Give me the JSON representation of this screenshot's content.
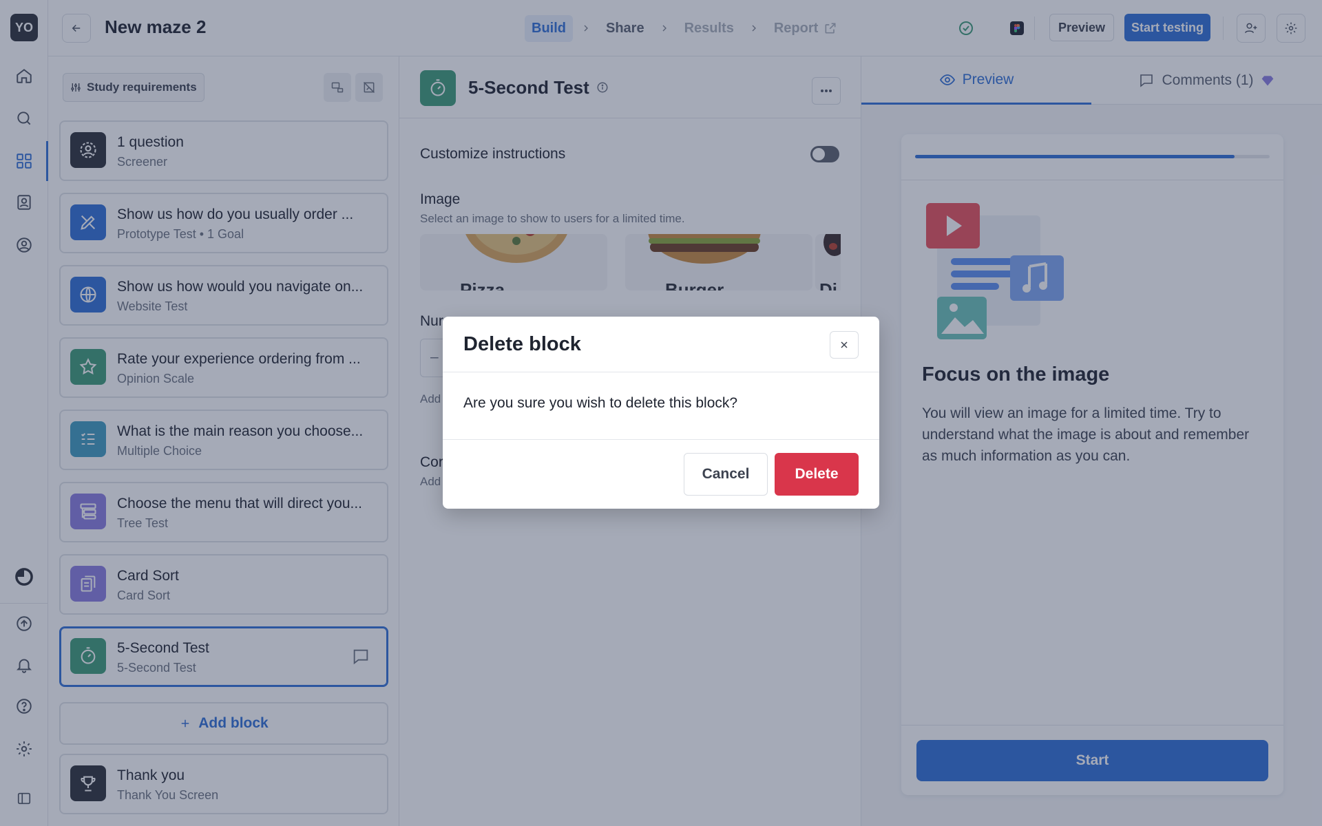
{
  "app": {
    "avatar_initials": "YO"
  },
  "header": {
    "title": "New maze 2",
    "steps": [
      {
        "label": "Build",
        "state": "active"
      },
      {
        "label": "Share",
        "state": "default"
      },
      {
        "label": "Results",
        "state": "disabled"
      },
      {
        "label": "Report",
        "state": "disabled"
      }
    ],
    "preview_label": "Preview",
    "start_testing_label": "Start testing"
  },
  "study": {
    "requirements_label": "Study requirements",
    "blocks": [
      {
        "title": "1 question",
        "subtitle": "Screener",
        "color": "#2b2f38",
        "icon": "screener-icon"
      },
      {
        "title": "Show us how do you usually order ...",
        "subtitle": "Prototype Test • 1 Goal",
        "color": "#2f6fd6",
        "icon": "prototype-icon"
      },
      {
        "title": "Show us how would you navigate on...",
        "subtitle": "Website Test",
        "color": "#2f6fd6",
        "icon": "globe-icon"
      },
      {
        "title": "Rate your experience ordering from ...",
        "subtitle": "Opinion Scale",
        "color": "#3d9c77",
        "icon": "star-icon"
      },
      {
        "title": "What is the main reason you choose...",
        "subtitle": "Multiple Choice",
        "color": "#3e9bc0",
        "icon": "checklist-icon"
      },
      {
        "title": "Choose the menu that will direct you...",
        "subtitle": "Tree Test",
        "color": "#8a7de0",
        "icon": "tree-icon"
      },
      {
        "title": "Card Sort",
        "subtitle": "Card Sort",
        "color": "#8a7de0",
        "icon": "card-sort-icon"
      },
      {
        "title": "5-Second Test",
        "subtitle": "5-Second Test",
        "color": "#3d9c77",
        "icon": "timer-icon",
        "selected": true
      }
    ],
    "add_block_label": "Add block",
    "thank_you": {
      "title": "Thank you",
      "subtitle": "Thank You Screen",
      "color": "#2b2f38",
      "icon": "trophy-icon"
    }
  },
  "editor": {
    "title": "5-Second Test",
    "customize_label": "Customize instructions",
    "customize_enabled": false,
    "image_label": "Image",
    "image_help": "Select an image to show to users for a limited time.",
    "images": [
      "Pizza",
      "Burger",
      "Di"
    ],
    "fragments": {
      "num_label": "Nur",
      "stepper": "–",
      "add_1": "Add",
      "con_label": "Cor",
      "add_2": "Add"
    }
  },
  "preview": {
    "tabs": [
      {
        "label": "Preview",
        "active": true
      },
      {
        "label": "Comments (1)",
        "active": false
      }
    ],
    "progress": 0.9,
    "heading": "Focus on the image",
    "body": "You will view an image for a limited time. Try to understand what the image is about and remember as much information as you can.",
    "start_label": "Start"
  },
  "modal": {
    "title": "Delete block",
    "message": "Are you sure you wish to delete this block?",
    "cancel_label": "Cancel",
    "delete_label": "Delete"
  },
  "colors": {
    "accent": "#2f6fd6",
    "danger": "#d9364b",
    "success": "#3d9c77"
  }
}
